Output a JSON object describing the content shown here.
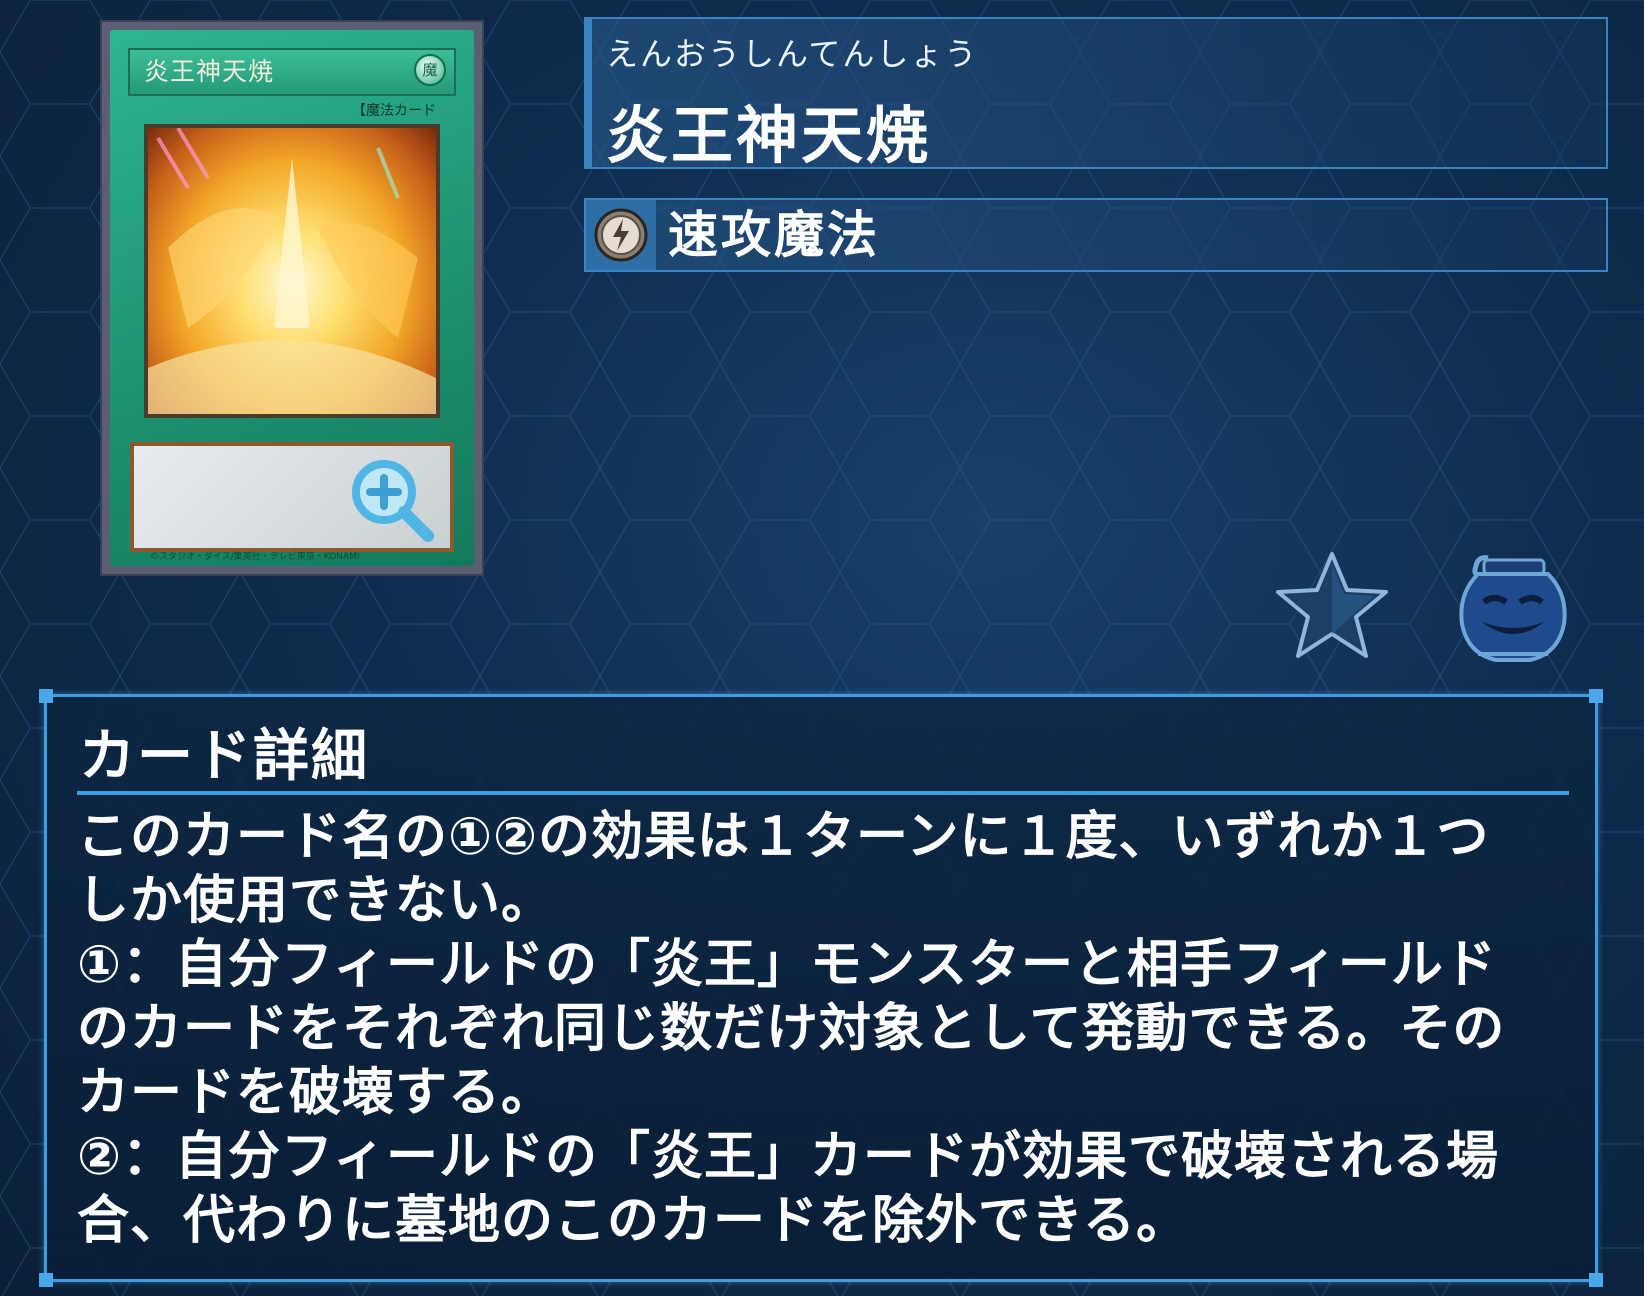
{
  "card": {
    "furigana": "えんおうしんてんしょう",
    "name": "炎王神天焼",
    "type_label": "速攻魔法",
    "art_title": "炎王神天焼",
    "art_attribute": "魔",
    "art_type_line": "【魔法カード",
    "art_copyright": "©スタジオ・ダイス/集英社・テレビ東京・KONAMI"
  },
  "detail": {
    "heading": "カード詳細",
    "text": "このカード名の①②の効果は１ターンに１度、いずれか１つ\nしか使用できない。\n①：自分フィールドの「炎王」モンスターと相手フィールド\nのカードをそれぞれ同じ数だけ対象として発動できる。その\nカードを破壊する。\n②：自分フィールドの「炎王」カードが効果で破壊される場\n合、代わりに墓地のこのカードを除外できる。"
  },
  "colors": {
    "background": "#0f2c4e",
    "panel_border": "#3f9ee2",
    "spell_card_green": "#1c8f6e"
  },
  "icons": {
    "zoom": "zoom-in-icon",
    "type": "quick-play-spell-icon",
    "favorite": "star-icon",
    "jar": "pot-of-greed-icon"
  }
}
